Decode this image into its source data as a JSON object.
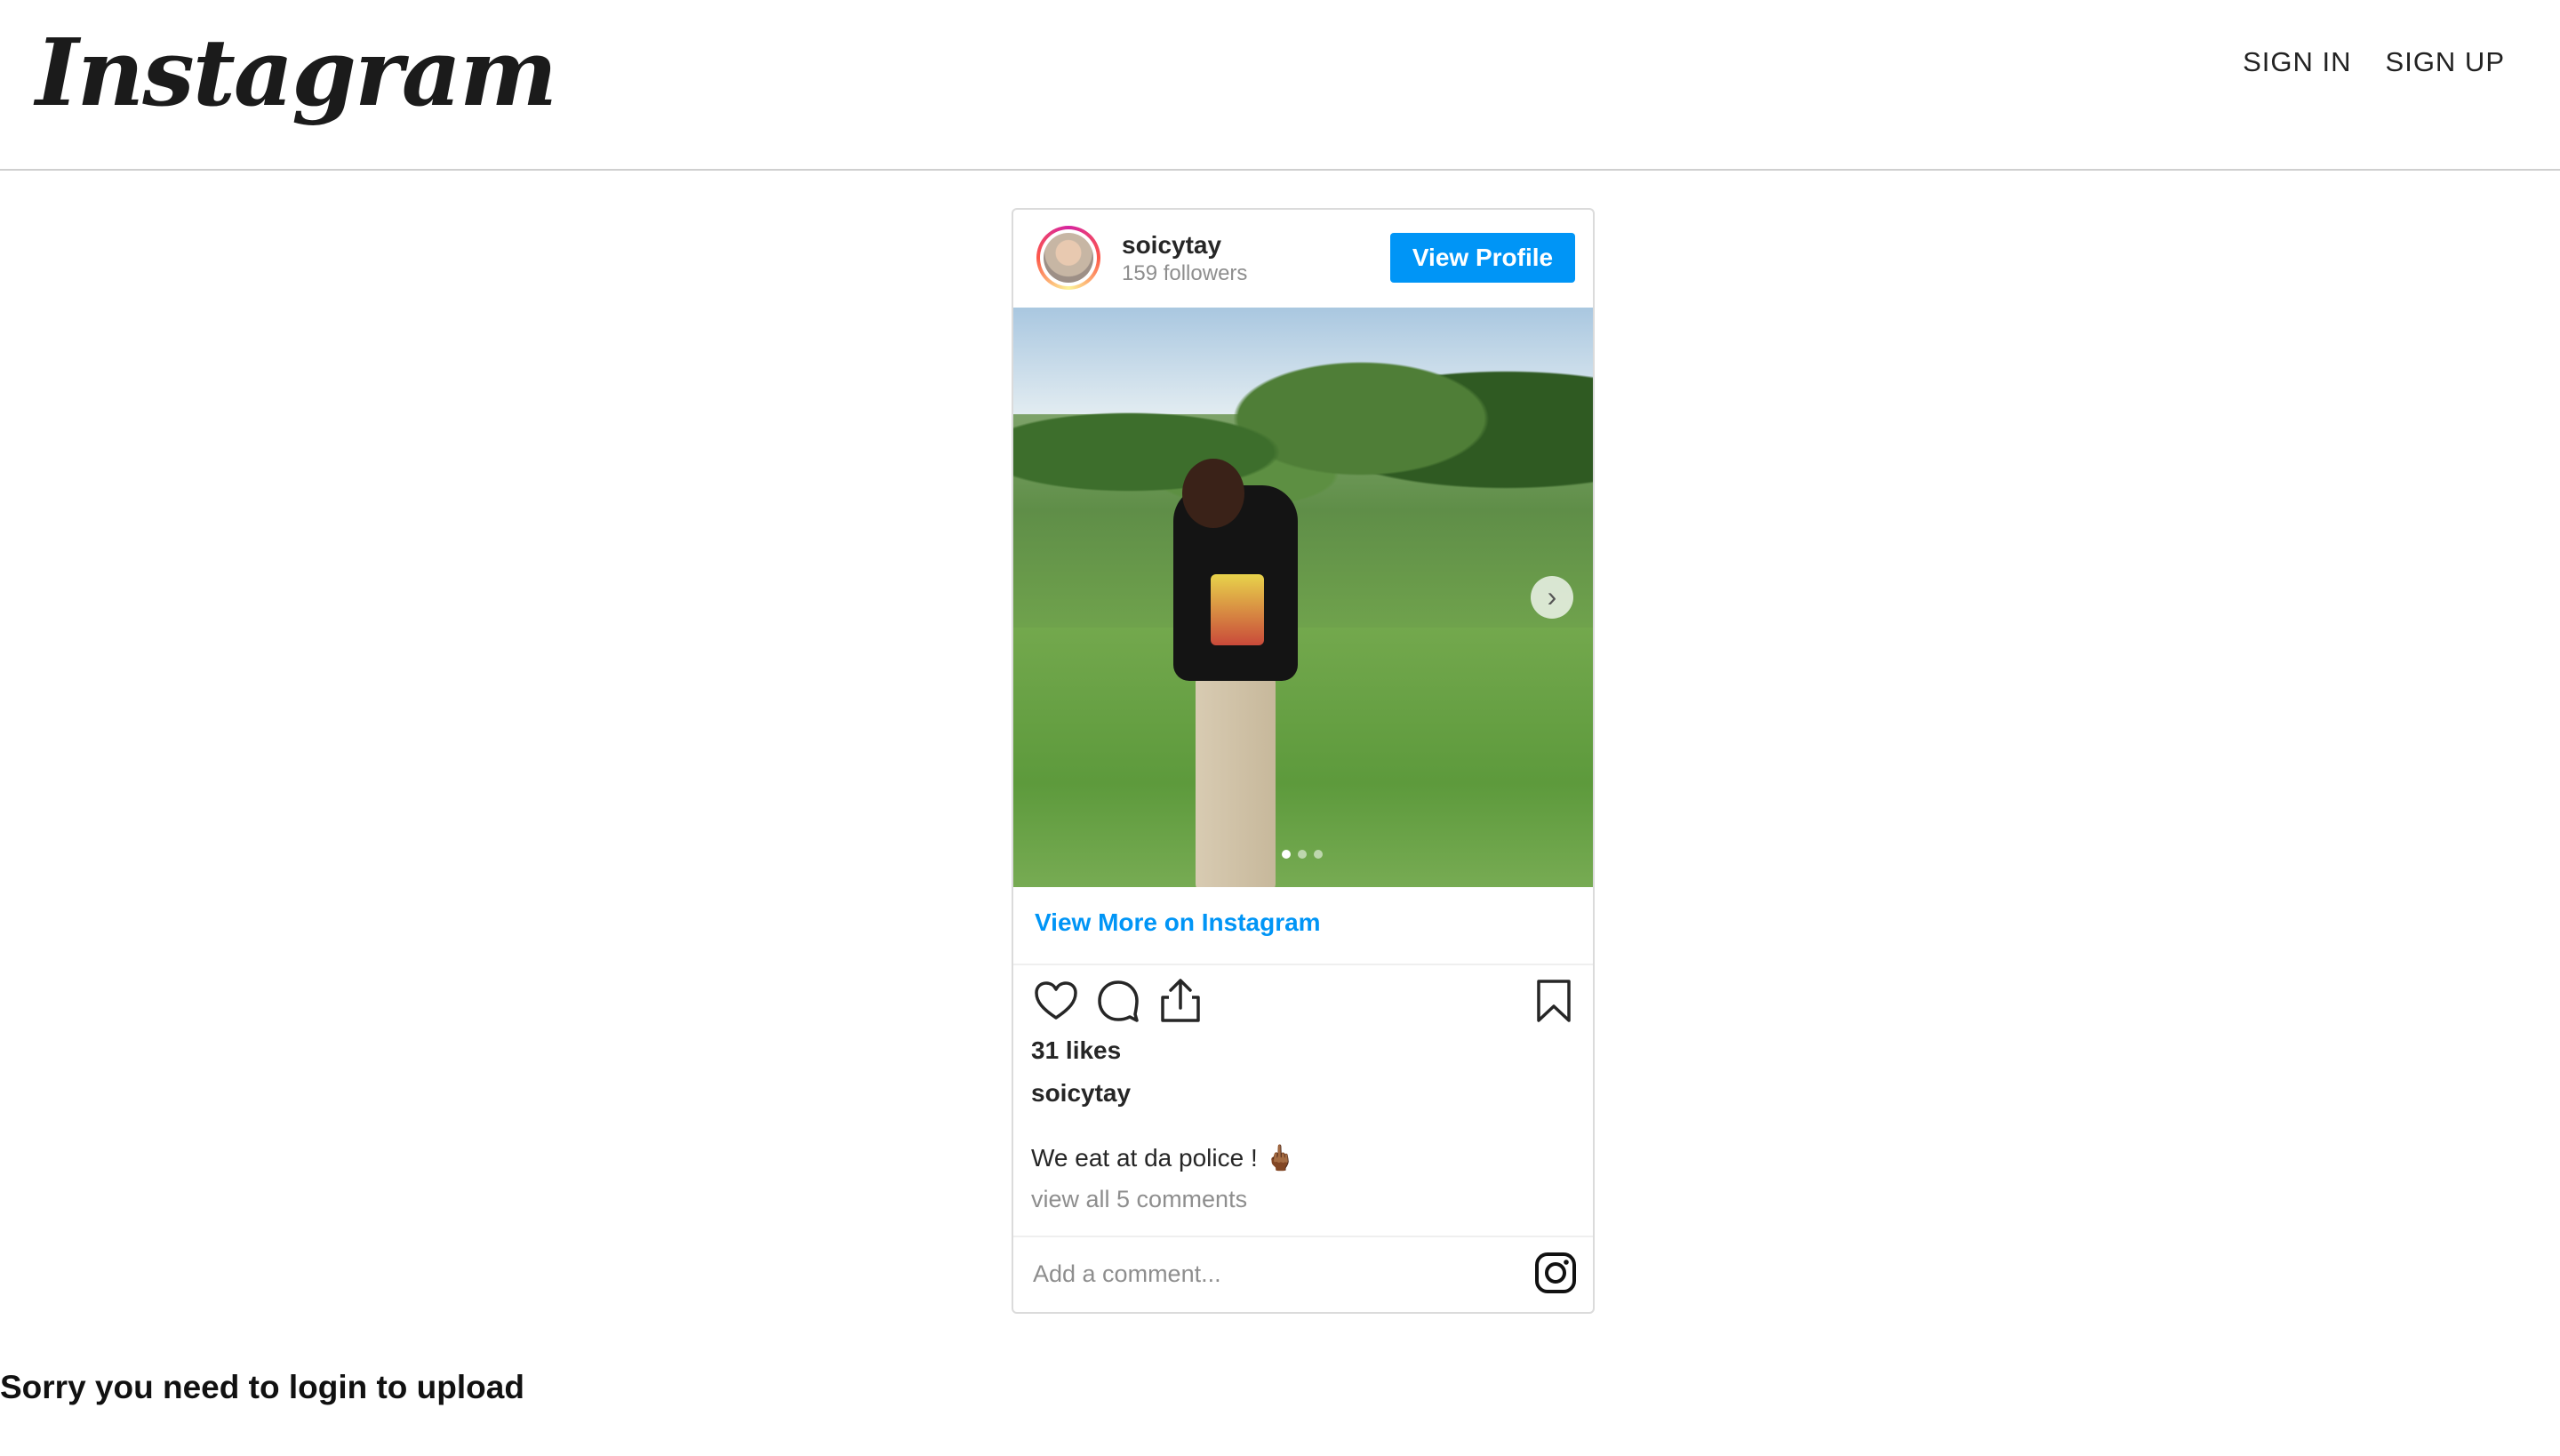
{
  "header": {
    "logo": "Instagram",
    "nav": {
      "sign_in": "SIGN IN",
      "sign_up": "SIGN UP"
    }
  },
  "post": {
    "username": "soicytay",
    "followers": "159 followers",
    "view_profile_label": "View Profile",
    "carousel": {
      "total": 3,
      "current": 1
    },
    "view_more_label": "View More on Instagram",
    "likes": "31 likes",
    "caption_user": "soicytay",
    "caption": "We eat at da police ! 🖕🏾",
    "view_comments": "view all 5 comments",
    "comment_placeholder": "Add a comment..."
  },
  "footer_message": "Sorry you need to login to upload",
  "colors": {
    "link_blue": "#0095f6",
    "border": "#dbdbdb",
    "muted": "#8e8e8e"
  }
}
